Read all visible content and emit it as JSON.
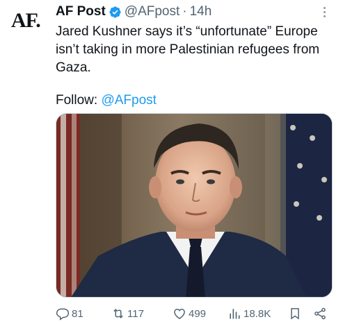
{
  "tweet": {
    "avatar_text": "AF.",
    "author_name": "AF Post",
    "handle": "@AFpost",
    "separator": "·",
    "time": "14h",
    "text_line1": "Jared Kushner says it’s “unfortunate” Europe",
    "text_line2": "isn’t taking in more Palestinian refugees from",
    "text_line3": "Gaza.",
    "follow_label": "Follow: ",
    "follow_mention": "@AFpost",
    "verified_color": "#1d9bf0"
  },
  "actions": {
    "replies": "81",
    "retweets": "117",
    "likes": "499",
    "views": "18.8K"
  },
  "icons": [
    "reply-icon",
    "retweet-icon",
    "like-icon",
    "views-icon",
    "bookmark-icon",
    "share-icon",
    "verified-badge-icon",
    "more-options-icon"
  ]
}
